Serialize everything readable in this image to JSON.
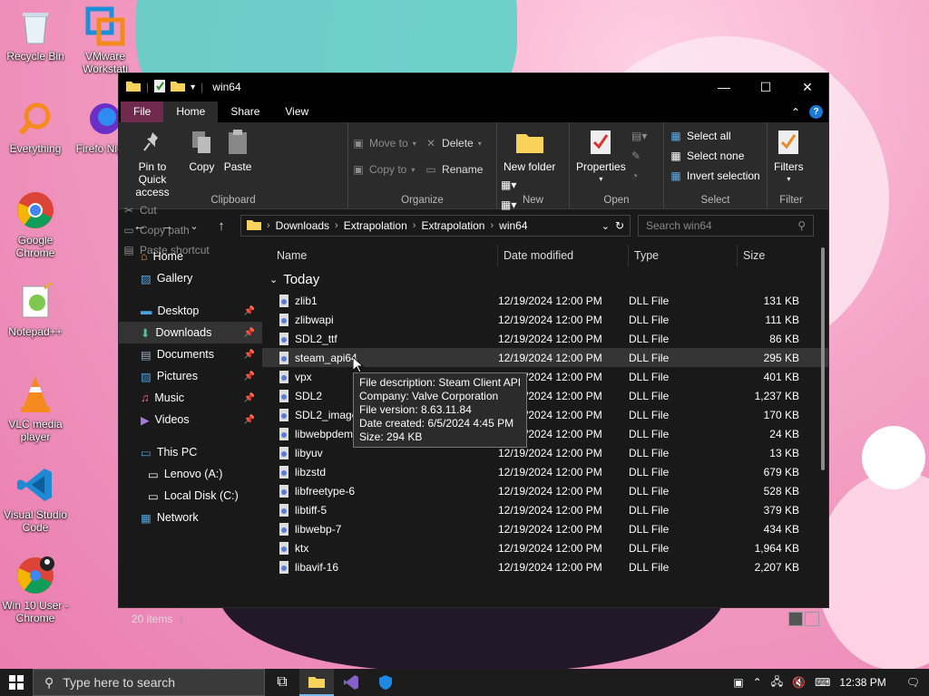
{
  "desktop": {
    "icons": [
      {
        "label": "Recycle Bin",
        "icon": "recycle-bin-icon"
      },
      {
        "label": "VMware Workstati",
        "icon": "vmware-icon"
      },
      {
        "label": "Everything",
        "icon": "everything-icon"
      },
      {
        "label": "Firefo Nightl",
        "icon": "firefox-nightly-icon"
      },
      {
        "label": "Google Chrome",
        "icon": "chrome-icon"
      },
      {
        "label": "Notepad++",
        "icon": "notepadpp-icon"
      },
      {
        "label": "VLC media player",
        "icon": "vlc-icon"
      },
      {
        "label": "Visual Studio Code",
        "icon": "vscode-icon"
      },
      {
        "label": "Win 10 User - Chrome",
        "icon": "chrome-user-icon"
      }
    ]
  },
  "explorer": {
    "title": "win64",
    "tabs": [
      "File",
      "Home",
      "Share",
      "View"
    ],
    "ribbon": {
      "clipboard": {
        "pin": "Pin to Quick access",
        "copy": "Copy",
        "paste": "Paste",
        "cut": "Cut",
        "copy_path": "Copy path",
        "paste_shortcut": "Paste shortcut",
        "label": "Clipboard"
      },
      "organize": {
        "move_to": "Move to",
        "copy_to": "Copy to",
        "delete": "Delete",
        "rename": "Rename",
        "label": "Organize"
      },
      "new": {
        "new_folder": "New folder",
        "label": "New"
      },
      "open": {
        "properties": "Properties",
        "label": "Open"
      },
      "select": {
        "select_all": "Select all",
        "select_none": "Select none",
        "invert": "Invert selection",
        "label": "Select"
      },
      "filters": {
        "filters": "Filters",
        "label": "Filter"
      }
    },
    "address": {
      "crumbs": [
        "Downloads",
        "Extrapolation",
        "Extrapolation",
        "win64"
      ]
    },
    "search_placeholder": "Search win64",
    "nav": {
      "home": "Home",
      "gallery": "Gallery",
      "quick": [
        "Desktop",
        "Downloads",
        "Documents",
        "Pictures",
        "Music",
        "Videos"
      ],
      "this_pc": "This PC",
      "drives": [
        "Lenovo (A:)",
        "Local Disk (C:)"
      ],
      "network": "Network"
    },
    "columns": {
      "name": "Name",
      "date": "Date modified",
      "type": "Type",
      "size": "Size"
    },
    "group": "Today",
    "files": [
      {
        "name": "zlib1",
        "date": "12/19/2024 12:00 PM",
        "type": "DLL File",
        "size": "131 KB"
      },
      {
        "name": "zlibwapi",
        "date": "12/19/2024 12:00 PM",
        "type": "DLL File",
        "size": "111 KB"
      },
      {
        "name": "SDL2_ttf",
        "date": "12/19/2024 12:00 PM",
        "type": "DLL File",
        "size": "86 KB"
      },
      {
        "name": "steam_api64",
        "date": "12/19/2024 12:00 PM",
        "type": "DLL File",
        "size": "295 KB"
      },
      {
        "name": "vpx",
        "date": "12/19/2024 12:00 PM",
        "type": "DLL File",
        "size": "401 KB"
      },
      {
        "name": "SDL2",
        "date": "12/19/2024 12:00 PM",
        "type": "DLL File",
        "size": "1,237 KB"
      },
      {
        "name": "SDL2_image",
        "date": "12/19/2024 12:00 PM",
        "type": "DLL File",
        "size": "170 KB"
      },
      {
        "name": "libwebpdemux",
        "date": "12/19/2024 12:00 PM",
        "type": "DLL File",
        "size": "24 KB"
      },
      {
        "name": "libyuv",
        "date": "12/19/2024 12:00 PM",
        "type": "DLL File",
        "size": "13 KB"
      },
      {
        "name": "libzstd",
        "date": "12/19/2024 12:00 PM",
        "type": "DLL File",
        "size": "679 KB"
      },
      {
        "name": "libfreetype-6",
        "date": "12/19/2024 12:00 PM",
        "type": "DLL File",
        "size": "528 KB"
      },
      {
        "name": "libtiff-5",
        "date": "12/19/2024 12:00 PM",
        "type": "DLL File",
        "size": "379 KB"
      },
      {
        "name": "libwebp-7",
        "date": "12/19/2024 12:00 PM",
        "type": "DLL File",
        "size": "434 KB"
      },
      {
        "name": "ktx",
        "date": "12/19/2024 12:00 PM",
        "type": "DLL File",
        "size": "1,964 KB"
      },
      {
        "name": "libavif-16",
        "date": "12/19/2024 12:00 PM",
        "type": "DLL File",
        "size": "2,207 KB"
      }
    ],
    "tooltip": [
      "File description: Steam Client API",
      "Company: Valve Corporation",
      "File version: 8.63.11.84",
      "Date created: 6/5/2024 4:45 PM",
      "Size: 294 KB"
    ],
    "status": "20 items"
  },
  "taskbar": {
    "search_placeholder": "Type here to search",
    "time": "12:38 PM"
  },
  "colors": {
    "accent": "#1b78d6",
    "file_tab": "#6f2a4d",
    "dark_bg": "#191919",
    "ribbon_bg": "#2b2b2b"
  }
}
